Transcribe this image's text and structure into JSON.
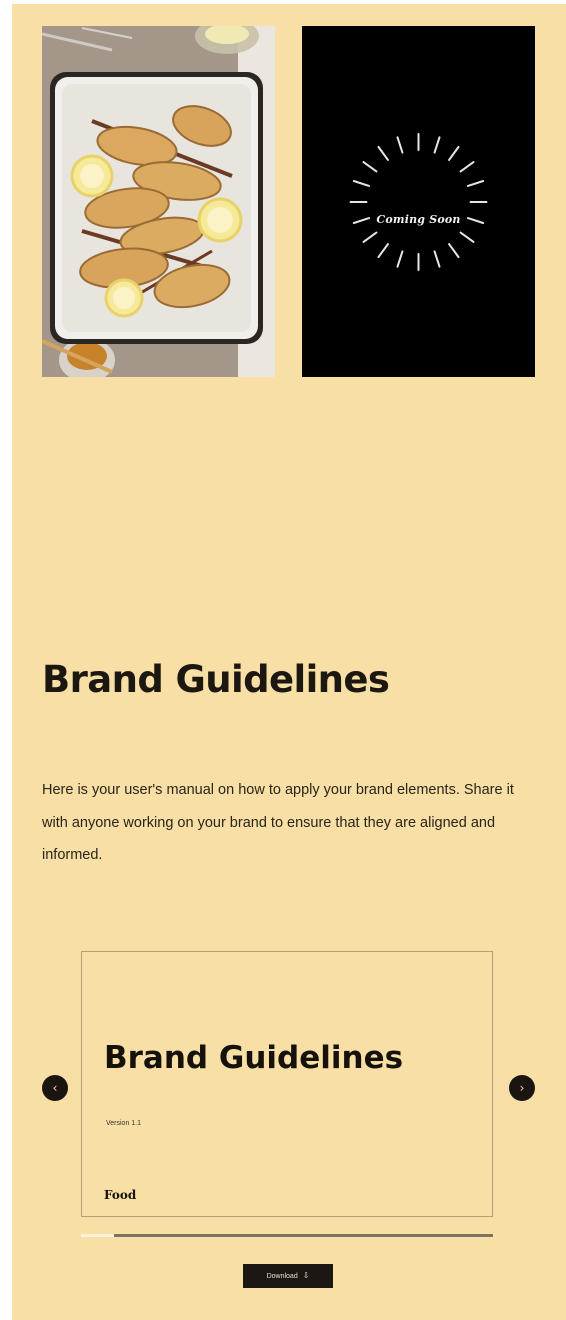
{
  "gallery": {
    "photo_icon": "roasted-pears-photo",
    "coming_soon_label": "Coming Soon"
  },
  "page": {
    "title": "Brand Guidelines",
    "intro": "Here is your user's manual on how to apply your brand elements. Share it with anyone working on your brand to ensure that they are aligned and informed."
  },
  "carousel": {
    "prev_label": "‹",
    "next_label": "›",
    "slide": {
      "title": "Brand Guidelines",
      "version": "Version 1.1",
      "category": "Food"
    },
    "progress": 0.08
  },
  "download": {
    "label": "Download",
    "icon": "download-icon"
  },
  "colors": {
    "background": "#f8dfa6",
    "dark": "#1a1510"
  }
}
